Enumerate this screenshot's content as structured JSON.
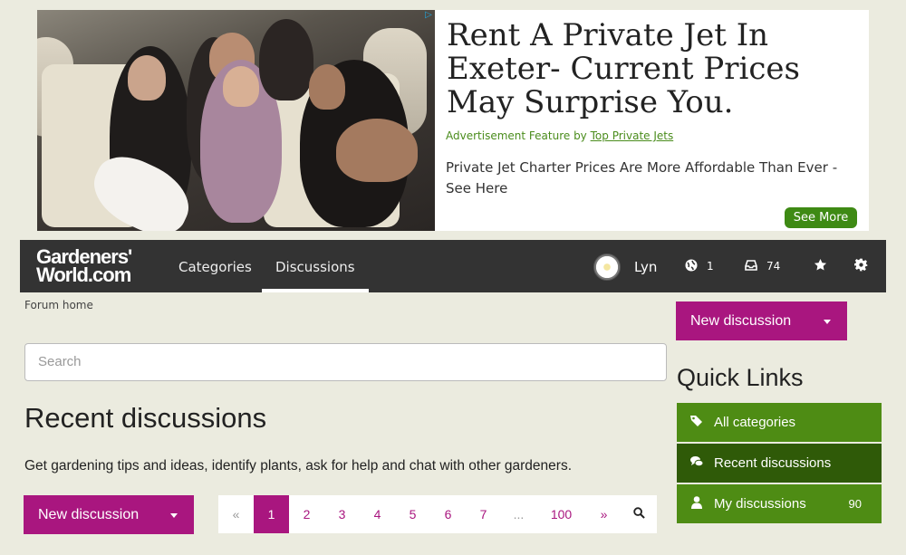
{
  "ad": {
    "title": "Rent A Private Jet In Exeter- Current Prices May Surprise You.",
    "sponsor_prefix": "Advertisement Feature by",
    "sponsor_link": "Top Private Jets",
    "description": "Private Jet Charter Prices Are More Affordable Than Ever - See Here",
    "cta": "See More"
  },
  "nav": {
    "logo_line1": "Gardeners'",
    "logo_line2": "World.com",
    "links": [
      "Categories",
      "Discussions"
    ],
    "active_link": "Discussions",
    "user": "Lyn",
    "notifications_count": "1",
    "inbox_count": "74"
  },
  "breadcrumb": "Forum home",
  "search": {
    "placeholder": "Search"
  },
  "main": {
    "title": "Recent discussions",
    "description": "Get gardening tips and ideas, identify plants, ask for help and chat with other gardeners.",
    "new_discussion": "New discussion"
  },
  "pager": {
    "prev": "«",
    "pages": [
      "1",
      "2",
      "3",
      "4",
      "5",
      "6",
      "7"
    ],
    "current": "1",
    "ellipsis": "...",
    "last": "100",
    "next": "»"
  },
  "sidebar": {
    "new_discussion": "New discussion",
    "quick_links_title": "Quick Links",
    "links": [
      {
        "label": "All categories",
        "icon": "tags-icon"
      },
      {
        "label": "Recent discussions",
        "icon": "comments-icon"
      },
      {
        "label": "My discussions",
        "icon": "user-icon",
        "count": "90"
      }
    ]
  },
  "colors": {
    "brand_magenta": "#a9167f",
    "brand_green": "#4e8c14",
    "nav_bg": "#333333"
  }
}
